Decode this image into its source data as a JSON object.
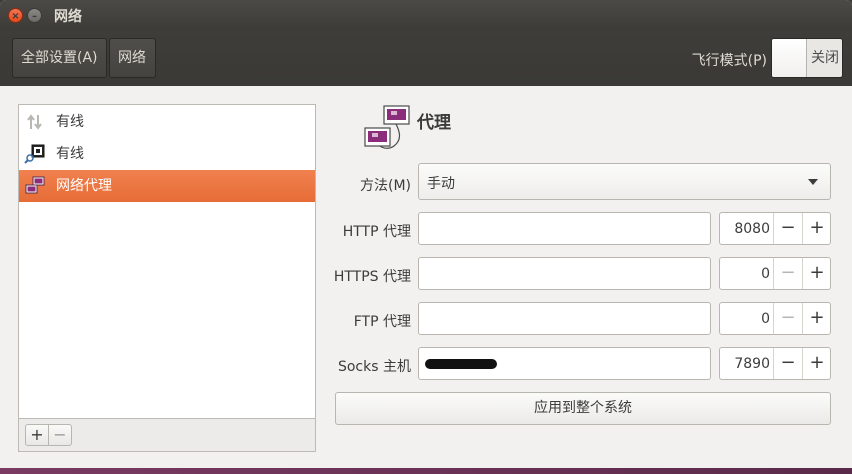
{
  "window": {
    "title": "网络",
    "close_glyph": "×",
    "minimize_glyph": "–"
  },
  "toolbar": {
    "all_settings_label": "全部设置(A)",
    "network_label": "网络",
    "airplane_mode_label": "飞行模式(P)",
    "airplane_mode_state": "关闭"
  },
  "sidebar": {
    "items": [
      {
        "label": "有线",
        "icon": "wired-arrows-icon",
        "selected": false
      },
      {
        "label": "有线",
        "icon": "network-search-icon",
        "selected": false
      },
      {
        "label": "网络代理",
        "icon": "network-proxy-icon",
        "selected": true
      }
    ],
    "add_label": "+",
    "remove_label": "−"
  },
  "proxy": {
    "title": "代理",
    "method_label": "方法(M)",
    "method_value": "手动",
    "rows": [
      {
        "label": "HTTP 代理",
        "host": "",
        "port": "8080",
        "minus_enabled": true
      },
      {
        "label": "HTTPS 代理",
        "host": "",
        "port": "0",
        "minus_enabled": false
      },
      {
        "label": "FTP 代理",
        "host": "",
        "port": "0",
        "minus_enabled": false
      },
      {
        "label": "Socks 主机",
        "host": "",
        "port": "7890",
        "minus_enabled": true,
        "host_redacted": true
      }
    ],
    "minus_glyph": "−",
    "plus_glyph": "+",
    "apply_label": "应用到整个系统"
  },
  "colors": {
    "accent": "#e96f38",
    "titlebar": "#3c3b37",
    "window_bg": "#f2f1f0"
  }
}
